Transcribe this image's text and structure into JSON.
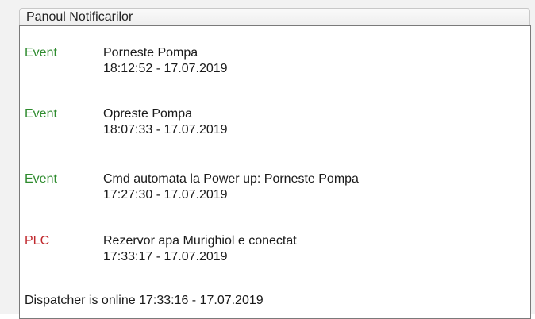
{
  "panel": {
    "title": "Panoul Notificarilor"
  },
  "colors": {
    "event": "#2e8b2e",
    "plc": "#c0282d"
  },
  "entries": [
    {
      "type": "Event",
      "message": "Porneste Pompa",
      "timestamp": "18:12:52 - 17.07.2019"
    },
    {
      "type": "Event",
      "message": "Opreste Pompa",
      "timestamp": "18:07:33 - 17.07.2019"
    },
    {
      "type": "Event",
      "message": "Cmd automata la Power up: Porneste Pompa",
      "timestamp": "17:27:30 - 17.07.2019"
    },
    {
      "type": "PLC",
      "message": "Rezervor apa Murighiol  e conectat",
      "timestamp": "17:33:17 - 17.07.2019"
    }
  ],
  "footer_entry": {
    "text": "Dispatcher is online 17:33:16 - 17.07.2019"
  }
}
